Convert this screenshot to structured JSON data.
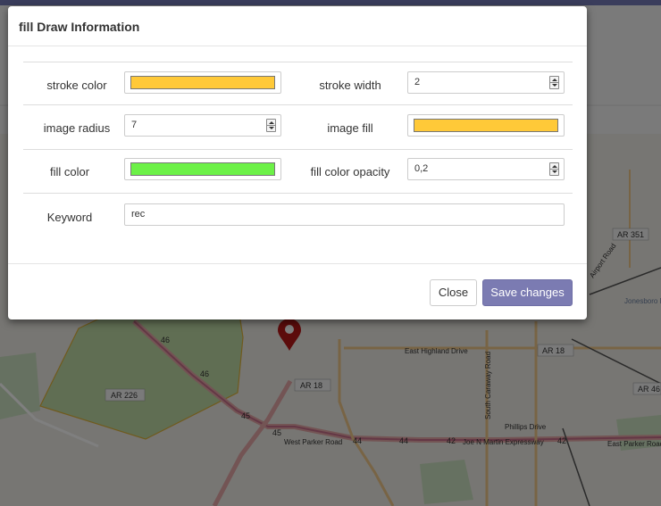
{
  "modal": {
    "title": "fill Draw Information",
    "fields": {
      "stroke_color": {
        "label": "stroke color",
        "color": "#ffc938"
      },
      "stroke_width": {
        "label": "stroke width",
        "value": "2"
      },
      "image_radius": {
        "label": "image radius",
        "value": "7"
      },
      "image_fill": {
        "label": "image fill",
        "color": "#ffc938"
      },
      "fill_color": {
        "label": "fill color",
        "color": "#6cf147"
      },
      "fill_color_opacity": {
        "label": "fill color opacity",
        "value": "0,2"
      },
      "keyword": {
        "label": "Keyword",
        "value": "rec"
      }
    },
    "buttons": {
      "close": "Close",
      "save": "Save changes"
    }
  },
  "map": {
    "labels": {
      "ar351": "AR 351",
      "ar18_right": "AR 18",
      "ar18": "AR 18",
      "ar226": "AR 226",
      "ar46": "AR 46",
      "east_highland": "East Highland Drive",
      "west_parker": "West Parker Road",
      "east_parker": "East Parker Road",
      "joe_martin": "Joe N Martin Expressway",
      "phillips": "Phillips Drive",
      "airport_rd": "Airport Road",
      "airport": "Jonesboro Municipal Airport",
      "caraway": "South Caraway Road",
      "route46": "46",
      "route45": "45",
      "route44": "44",
      "route42": "42"
    }
  },
  "colors": {
    "backdrop": "rgba(0,0,0,0.5)",
    "save_button": "#7b7bb2",
    "zone_fill": "#9ccf72",
    "zone_stroke": "#e0b53a",
    "marker": "#b81919"
  }
}
